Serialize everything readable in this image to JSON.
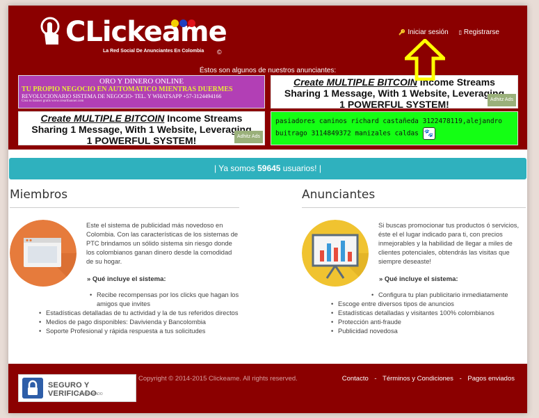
{
  "header": {
    "logo_text": "CLickeame",
    "logo_tagline": "La Red Social De Anunciantes En Colombia",
    "logo_copyright": "©",
    "login_label": "Iniciar sesión",
    "register_label": "Registrarse"
  },
  "ads": {
    "title": "Éstos son algunos de nuestros anunciantes:",
    "purple": {
      "line1": "ORO Y DINERO ONLINE",
      "line2": "TU PROPIO NEGOCIO EN AUTOMATICO MIENTRAS DUERMES",
      "line3": "REVOLUCIONARIO SISTEMA DE NEGOCIO- TEL. Y WHATSAPP +57-3124494166",
      "line4": "Crea tu banner gratis www.creartbanner.com"
    },
    "btc": {
      "highlight": "Create MULTIPLE BITCOIN",
      "rest1": " Income Streams",
      "rest2": "Sharing 1 Message, With 1 Website, Leveraging",
      "rest3": "1 POWERFUL SYSTEM!",
      "badge": "Adhitz Ads"
    },
    "green": {
      "text": "pasiadores caninos richard castañeda 3122478119,alejandro buitrago 3114849372 manizales caldas"
    }
  },
  "userbar": {
    "prefix": "|   Ya somos ",
    "count": "59645",
    "suffix": " usuarios!   |"
  },
  "members": {
    "title": "Miembros",
    "description": "Este el sistema de publicidad más novedoso en Colombia. Con las características de los sistemas de PTC brindamos un sólido sistema sin riesgo donde los colombianos ganan dinero desde la comodidad de su hogar.",
    "includes_label": "» Qué incluye el sistema:",
    "items": [
      "Recibe recompensas por los clicks que hagan los amigos que invites",
      "Estadísticas detalladas de tu actividad y la de tus referidos directos",
      "Medios de pago disponibles: Davivienda y Bancolombia",
      "Soporte Profesional y rápida respuesta a tus solicitudes"
    ]
  },
  "advertisers": {
    "title": "Anunciantes",
    "description": "Si buscas promocionar tus productos ó servicios, éste el el lugar indicado para ti, con precios inmejorables y la habilidad de llegar a miles de clientes potenciales, obtendrás las visitas que siempre deseaste!",
    "includes_label": "» Qué incluye el sistema:",
    "items": [
      "Configura tu plan publicitario inmediatamente",
      "Escoge entre diversos tipos de anuncios",
      "Estadísticas detalladas y visitantes 100% colombianos",
      "Protección anti-fraude",
      "Publicidad novedosa"
    ]
  },
  "footer": {
    "seal_title": "SEGURO Y VERIFICADO",
    "seal_sub": "COMPROBADO",
    "copyright": "Copyright © 2014-2015 Clickeame. All rights reserved.",
    "links": [
      "Contacto",
      "Términos y Condiciones",
      "Pagos enviados"
    ],
    "separator": "-"
  },
  "colors": {
    "brand": "#8b0000",
    "accent": "#2fb1be",
    "arrow": "#ffff00"
  },
  "icons": [
    "hand-pointer-icon",
    "key-icon",
    "register-icon",
    "browser-window-icon",
    "presentation-chart-icon",
    "padlock-icon",
    "paw-icon",
    "arrow-up-icon"
  ]
}
